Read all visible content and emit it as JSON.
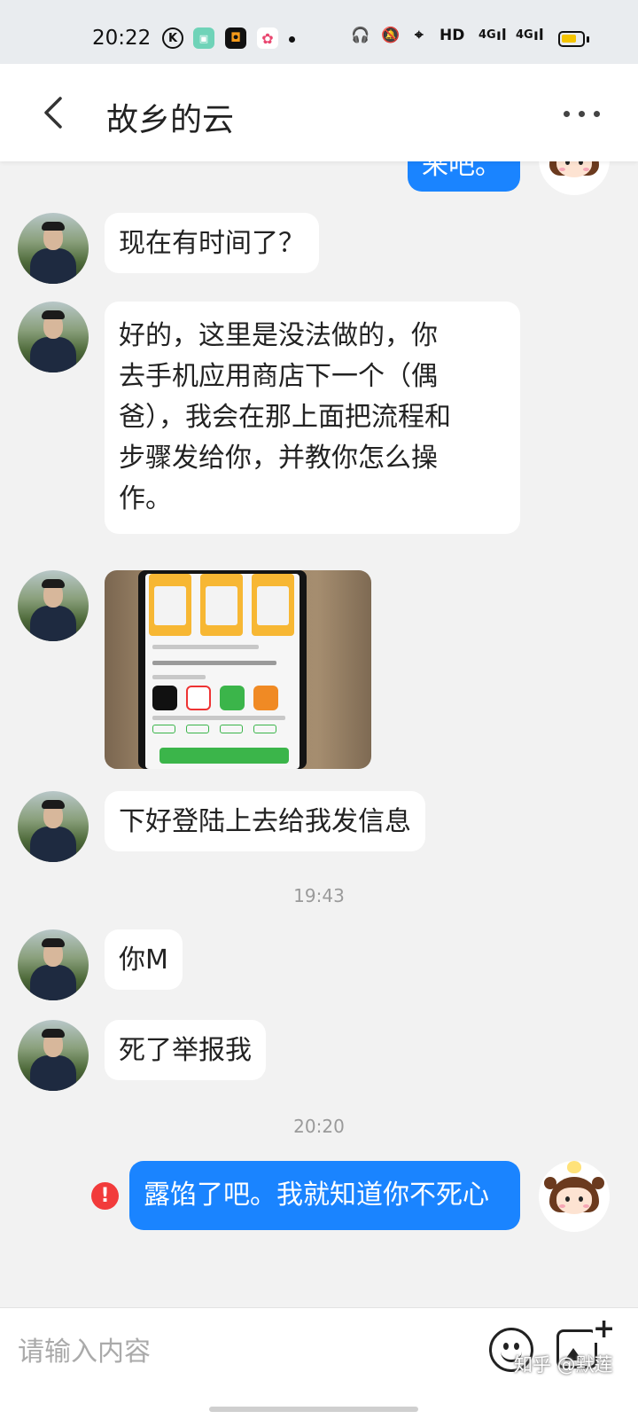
{
  "status_bar": {
    "time": "20:22",
    "k_icon": "K",
    "network": "HD",
    "signal1": "4G",
    "signal2": "4G",
    "battery_level": 0.75
  },
  "header": {
    "title": "故乡的云"
  },
  "messages": [
    {
      "side": "right",
      "text": "来吧。"
    },
    {
      "side": "left",
      "text": "现在有时间了？"
    },
    {
      "side": "left",
      "lines": [
        "好的，这里是没法做的，你",
        "去手机应用商店下一个（偶",
        "爸），我会在那上面把流程和",
        "步骤发给你，并教你怎么操",
        "作。"
      ]
    },
    {
      "side": "left",
      "type": "image",
      "image_label": "phone-app-store-photo"
    },
    {
      "side": "left",
      "text": "下好登陆上去给我发信息"
    },
    {
      "type": "time",
      "text": "19:43"
    },
    {
      "side": "left",
      "text": "你M"
    },
    {
      "side": "left",
      "text": "死了举报我"
    },
    {
      "type": "time",
      "text": "20:20"
    },
    {
      "side": "right",
      "text": "露馅了吧。我就知道你不死心",
      "status": "failed"
    }
  ],
  "input_bar": {
    "placeholder": "请输入内容",
    "watermark": "知乎 @默莲"
  },
  "icons": {
    "back": "chevron-left-icon",
    "more": "more-horizontal-icon",
    "emoji": "emoji-icon",
    "image": "add-image-icon",
    "error": "error-icon"
  }
}
